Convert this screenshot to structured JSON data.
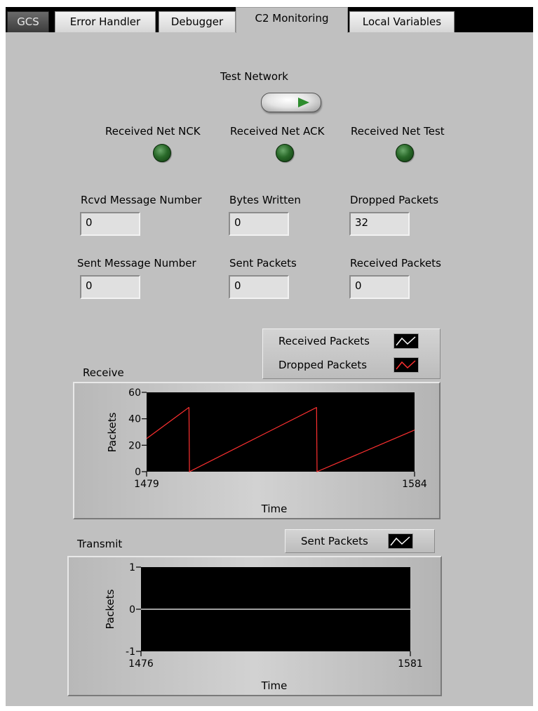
{
  "tabs": [
    {
      "label": "GCS"
    },
    {
      "label": "Error Handler"
    },
    {
      "label": "Debugger"
    },
    {
      "label": "C2 Monitoring"
    },
    {
      "label": "Local Variables"
    }
  ],
  "active_tab": "C2 Monitoring",
  "test_network": {
    "label": "Test Network"
  },
  "indicators": [
    {
      "label": "Received Net NCK",
      "state": "off"
    },
    {
      "label": "Received Net ACK",
      "state": "off"
    },
    {
      "label": "Received Net Test",
      "state": "off"
    }
  ],
  "fields": {
    "rcvd_message_number": {
      "label": "Rcvd Message Number",
      "value": "0"
    },
    "bytes_written": {
      "label": "Bytes Written",
      "value": "0"
    },
    "dropped_packets": {
      "label": "Dropped Packets",
      "value": "32"
    },
    "sent_message_number": {
      "label": "Sent Message Number",
      "value": "0"
    },
    "sent_packets": {
      "label": "Sent Packets",
      "value": "0"
    },
    "received_packets": {
      "label": "Received Packets",
      "value": "0"
    }
  },
  "colors": {
    "panel_bg": "#c0c0c0",
    "plot_bg": "#000000",
    "dropped_series": "#ff3030",
    "received_series": "#ffffff",
    "sent_series": "#ffffff",
    "led_off": "#2a6a2a"
  },
  "receive_chart": {
    "title": "Receive",
    "legend": [
      {
        "name": "Received Packets",
        "color": "#ffffff"
      },
      {
        "name": "Dropped Packets",
        "color": "#ff3030"
      }
    ],
    "ylabel": "Packets",
    "xlabel": "Time",
    "y_ticks": [
      "60",
      "40",
      "20",
      "0"
    ],
    "x_ticks": [
      "1479",
      "1584"
    ]
  },
  "transmit_chart": {
    "title": "Transmit",
    "legend": [
      {
        "name": "Sent Packets",
        "color": "#ffffff"
      }
    ],
    "ylabel": "Packets",
    "xlabel": "Time",
    "y_ticks": [
      "1",
      "0",
      "-1"
    ],
    "x_ticks": [
      "1476",
      "1581"
    ]
  },
  "chart_data": [
    {
      "type": "line",
      "title": "Receive",
      "xlabel": "Time",
      "ylabel": "Packets",
      "xlim": [
        1479,
        1584
      ],
      "ylim": [
        0,
        60
      ],
      "series": [
        {
          "name": "Dropped Packets",
          "x": [
            1479,
            1495.5,
            1495.6,
            1495.8,
            1545.5,
            1545.6,
            1545.8,
            1584
          ],
          "y": [
            25,
            48.5,
            48.5,
            0,
            48.5,
            48.5,
            0,
            31.5
          ]
        }
      ],
      "legend": [
        "Received Packets",
        "Dropped Packets"
      ]
    },
    {
      "type": "line",
      "title": "Transmit",
      "xlabel": "Time",
      "ylabel": "Packets",
      "xlim": [
        1476,
        1581
      ],
      "ylim": [
        -1,
        1
      ],
      "series": [
        {
          "name": "Sent Packets",
          "x": [
            1476,
            1581
          ],
          "y": [
            0,
            0
          ]
        }
      ],
      "legend": [
        "Sent Packets"
      ]
    }
  ]
}
